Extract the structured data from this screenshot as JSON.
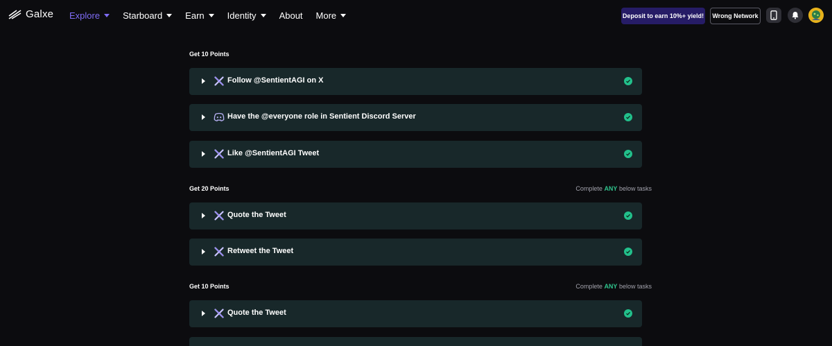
{
  "brand": {
    "name": "Galxe"
  },
  "nav": {
    "items": [
      {
        "label": "Explore",
        "active": true,
        "has_caret": true
      },
      {
        "label": "Starboard",
        "active": false,
        "has_caret": true
      },
      {
        "label": "Earn",
        "active": false,
        "has_caret": true
      },
      {
        "label": "Identity",
        "active": false,
        "has_caret": true
      },
      {
        "label": "About",
        "active": false,
        "has_caret": false
      },
      {
        "label": "More",
        "active": false,
        "has_caret": true
      }
    ]
  },
  "header_actions": {
    "deposit_label": "Deposit to earn 10%+ yield!",
    "network_label": "Wrong Network",
    "icons": [
      "mobile-icon",
      "bell-icon",
      "avatar"
    ]
  },
  "sections": [
    {
      "title": "Get 10 Points",
      "note": null,
      "tasks": [
        {
          "icon": "x-icon",
          "label": "Follow @SentientAGI on X",
          "completed": true
        },
        {
          "icon": "discord-icon",
          "label": "Have the @everyone role in Sentient Discord Server",
          "completed": true
        },
        {
          "icon": "x-icon",
          "label": "Like @SentientAGI Tweet",
          "completed": true
        }
      ]
    },
    {
      "title": "Get 20 Points",
      "note": {
        "prefix": "Complete",
        "highlight": "ANY",
        "suffix": "below tasks"
      },
      "tasks": [
        {
          "icon": "x-icon",
          "label": "Quote the Tweet",
          "completed": true
        },
        {
          "icon": "x-icon",
          "label": "Retweet the Tweet",
          "completed": true
        }
      ]
    },
    {
      "title": "Get 10 Points",
      "note": {
        "prefix": "Complete",
        "highlight": "ANY",
        "suffix": "below tasks"
      },
      "tasks": [
        {
          "icon": "x-icon",
          "label": "Quote the Tweet",
          "completed": true
        },
        {
          "icon": "",
          "label": "",
          "completed": false
        }
      ]
    }
  ],
  "colors": {
    "background": "#0c0c0f",
    "card": "#18282a",
    "accent_nav": "#7f6cf5",
    "success": "#22c08b",
    "deposit_bg": "#261c66"
  }
}
